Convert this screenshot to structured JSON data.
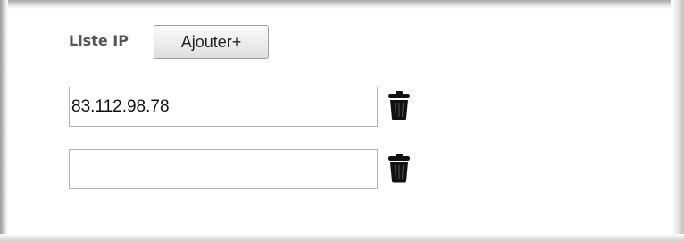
{
  "ip_list": {
    "label": "Liste IP",
    "add_button_label": "Ajouter+",
    "entries": [
      {
        "value": "83.112.98.78",
        "delete_icon": "trash-icon"
      },
      {
        "value": "",
        "delete_icon": "trash-icon"
      }
    ]
  }
}
